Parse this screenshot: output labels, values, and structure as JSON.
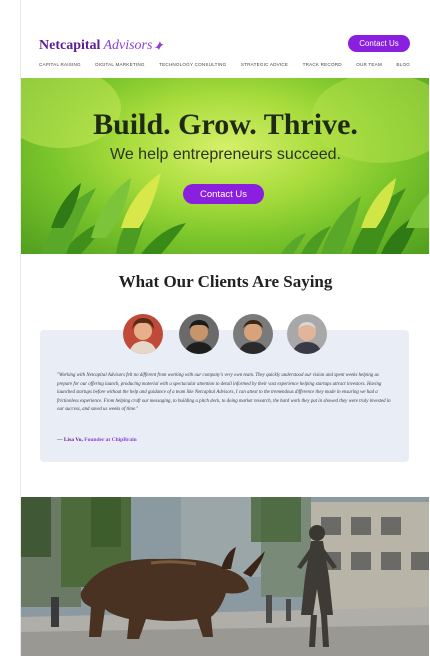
{
  "header": {
    "brand": "Netcapital",
    "brand_sub": "Advisors",
    "cta_label": "Contact Us",
    "nav": [
      "Capital Raising",
      "Digital Marketing",
      "Technology Consulting",
      "Strategic Advice",
      "Track Record",
      "Our Team",
      "Blog"
    ]
  },
  "hero": {
    "title": "Build. Grow. Thrive.",
    "subtitle": "We help entrepreneurs succeed.",
    "cta_label": "Contact Us"
  },
  "testimonials": {
    "title": "What Our Clients Are Saying",
    "quote": "\"Working with Netcapital Advisors felt no different from working with our company's very own team. They quickly understood our vision and spent weeks helping us prepare for our offering launch, producing material with a spectacular attention to detail informed by their vast experience helping startups attract investors. Having launched startups before without the help and guidance of a team like Netcapital Advisors, I can attest to the tremendous difference they made in ensuring we had a frictionless experience. From helping craft our messaging, to building a pitch deck, to doing market research, the hard work they put in showed they were truly invested in our success, and saved us weeks of time.\"",
    "author_name": "— Lisa Vo,",
    "author_role": "Founder at ChipBrain"
  },
  "colors": {
    "accent": "#8a1fe0",
    "brand": "#5b1e96",
    "card": "#e9edf6"
  }
}
